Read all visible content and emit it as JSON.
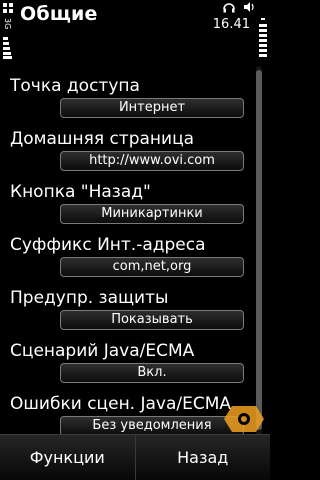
{
  "header": {
    "title": "Общие",
    "time": "16.41",
    "signal_label": "3G",
    "icons": [
      "options-icon",
      "signal-icon",
      "headset-icon",
      "volume-icon",
      "battery-icon"
    ]
  },
  "settings": [
    {
      "label": "Точка доступа",
      "value": "Интернет"
    },
    {
      "label": "Домашняя страница",
      "value": "http://www.ovi.com"
    },
    {
      "label": "Кнопка \"Назад\"",
      "value": "Миникартинки"
    },
    {
      "label": "Суффикс Инт.-адреса",
      "value": "com,net,org"
    },
    {
      "label": "Предупр. защиты",
      "value": "Показывать"
    },
    {
      "label": "Сценарий Java/ECMA",
      "value": "Вкл."
    },
    {
      "label": "Ошибки сцен. Java/ECMA",
      "value": "Без уведомления"
    }
  ],
  "softkeys": {
    "left": "Функции",
    "right": "Назад"
  },
  "colors": {
    "background": "#000000",
    "text": "#ffffff",
    "field_border": "#7a7a7a",
    "watermark": "#f0a020"
  }
}
